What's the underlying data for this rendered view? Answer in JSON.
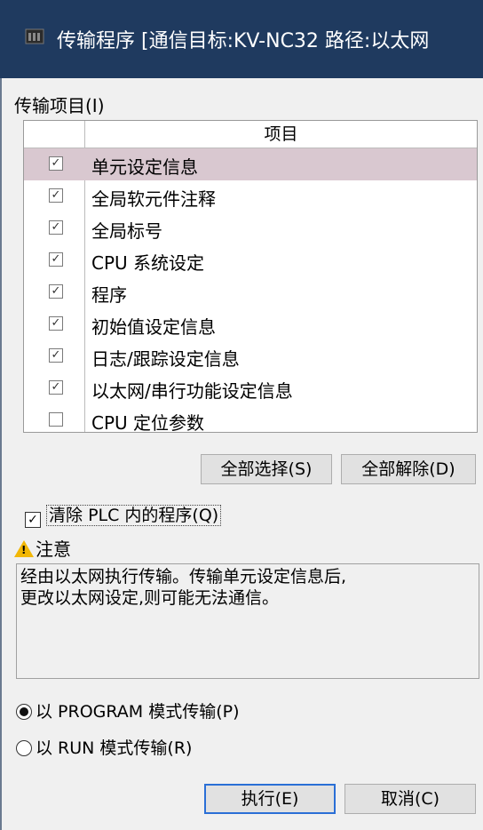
{
  "window": {
    "title": "传输程序 [通信目标:KV-NC32 路径:以太网"
  },
  "transfer_items": {
    "group_label": "传输项目(I)",
    "column_header": "项目",
    "items": [
      {
        "label": "单元设定信息",
        "checked": true,
        "selected": true
      },
      {
        "label": "全局软元件注释",
        "checked": true,
        "selected": false
      },
      {
        "label": "全局标号",
        "checked": true,
        "selected": false
      },
      {
        "label": "CPU 系统设定",
        "checked": true,
        "selected": false
      },
      {
        "label": "程序",
        "checked": true,
        "selected": false
      },
      {
        "label": "初始值设定信息",
        "checked": true,
        "selected": false
      },
      {
        "label": "日志/跟踪设定信息",
        "checked": true,
        "selected": false
      },
      {
        "label": "以太网/串行功能设定信息",
        "checked": true,
        "selected": false
      },
      {
        "label": "CPU 定位参数",
        "checked": false,
        "selected": false
      }
    ],
    "select_all_label": "全部选择(S)",
    "deselect_all_label": "全部解除(D)"
  },
  "clear_plc": {
    "label": "清除 PLC 内的程序(Q)",
    "checked": true
  },
  "notice": {
    "title": "注意",
    "text_line1": "经由以太网执行传输。传输单元设定信息后,",
    "text_line2": "更改以太网设定,则可能无法通信。"
  },
  "mode": {
    "program_label": "以 PROGRAM 模式传输(P)",
    "run_label": "以 RUN 模式传输(R)",
    "selected": "program"
  },
  "actions": {
    "execute_label": "执行(E)",
    "cancel_label": "取消(C)"
  },
  "colors": {
    "titlebar": "#1f3a5f",
    "selected_row": "#d9c8d0",
    "warning": "#f2b705",
    "default_button_border": "#2a6fd6"
  }
}
